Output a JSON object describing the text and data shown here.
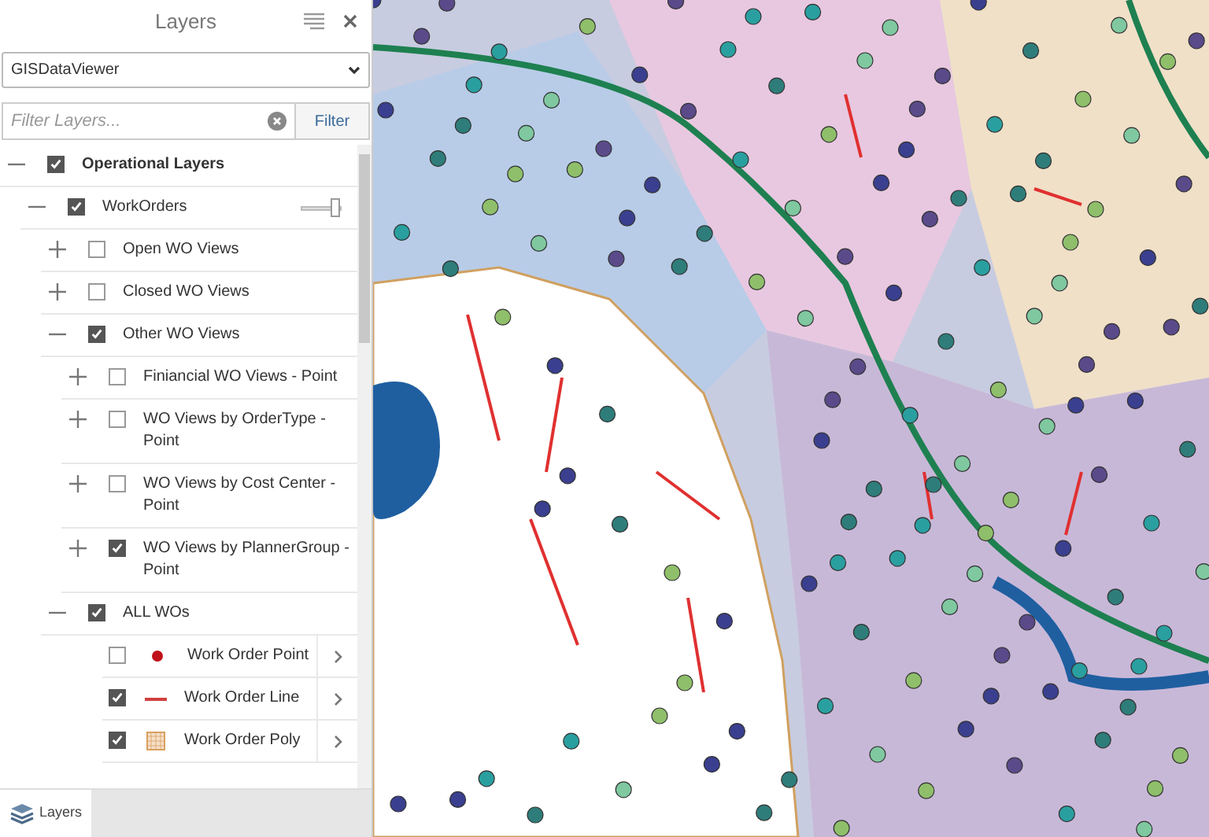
{
  "panel": {
    "title": "Layers",
    "dropdown": {
      "value": "GISDataViewer"
    },
    "filter": {
      "placeholder": "Filter Layers...",
      "button": "Filter"
    }
  },
  "tree": [
    {
      "label": "Operational Layers",
      "kind": "root",
      "checked": true,
      "expanded": true,
      "children": [
        {
          "label": "WorkOrders",
          "kind": "group",
          "checked": true,
          "expanded": true,
          "opacity": {
            "level": 0.95
          },
          "children": [
            {
              "label": "Open WO Views",
              "kind": "group",
              "checked": false,
              "expanded": false
            },
            {
              "label": "Closed WO Views",
              "kind": "group",
              "checked": false,
              "expanded": false
            },
            {
              "label": "Other WO Views",
              "kind": "group",
              "checked": true,
              "expanded": true,
              "children": [
                {
                  "label": "Finiancial WO Views - Point",
                  "kind": "group",
                  "checked": false,
                  "expanded": false
                },
                {
                  "label": "WO Views by OrderType - Point",
                  "kind": "group",
                  "checked": false,
                  "expanded": false
                },
                {
                  "label": "WO Views by Cost Center - Point",
                  "kind": "group",
                  "checked": false,
                  "expanded": false
                },
                {
                  "label": "WO Views by PlannerGroup - Point",
                  "kind": "group",
                  "checked": true,
                  "expanded": false
                }
              ]
            },
            {
              "label": "ALL WOs",
              "kind": "group",
              "checked": true,
              "expanded": true,
              "children": [
                {
                  "label": "Work Order Point",
                  "kind": "point",
                  "checked": false
                },
                {
                  "label": "Work Order Line",
                  "kind": "line",
                  "checked": true
                },
                {
                  "label": "Work Order Poly",
                  "kind": "poly",
                  "checked": true
                }
              ]
            }
          ]
        }
      ]
    }
  ],
  "bottom_tabs": [
    {
      "label": "Layers",
      "selected": true
    }
  ]
}
